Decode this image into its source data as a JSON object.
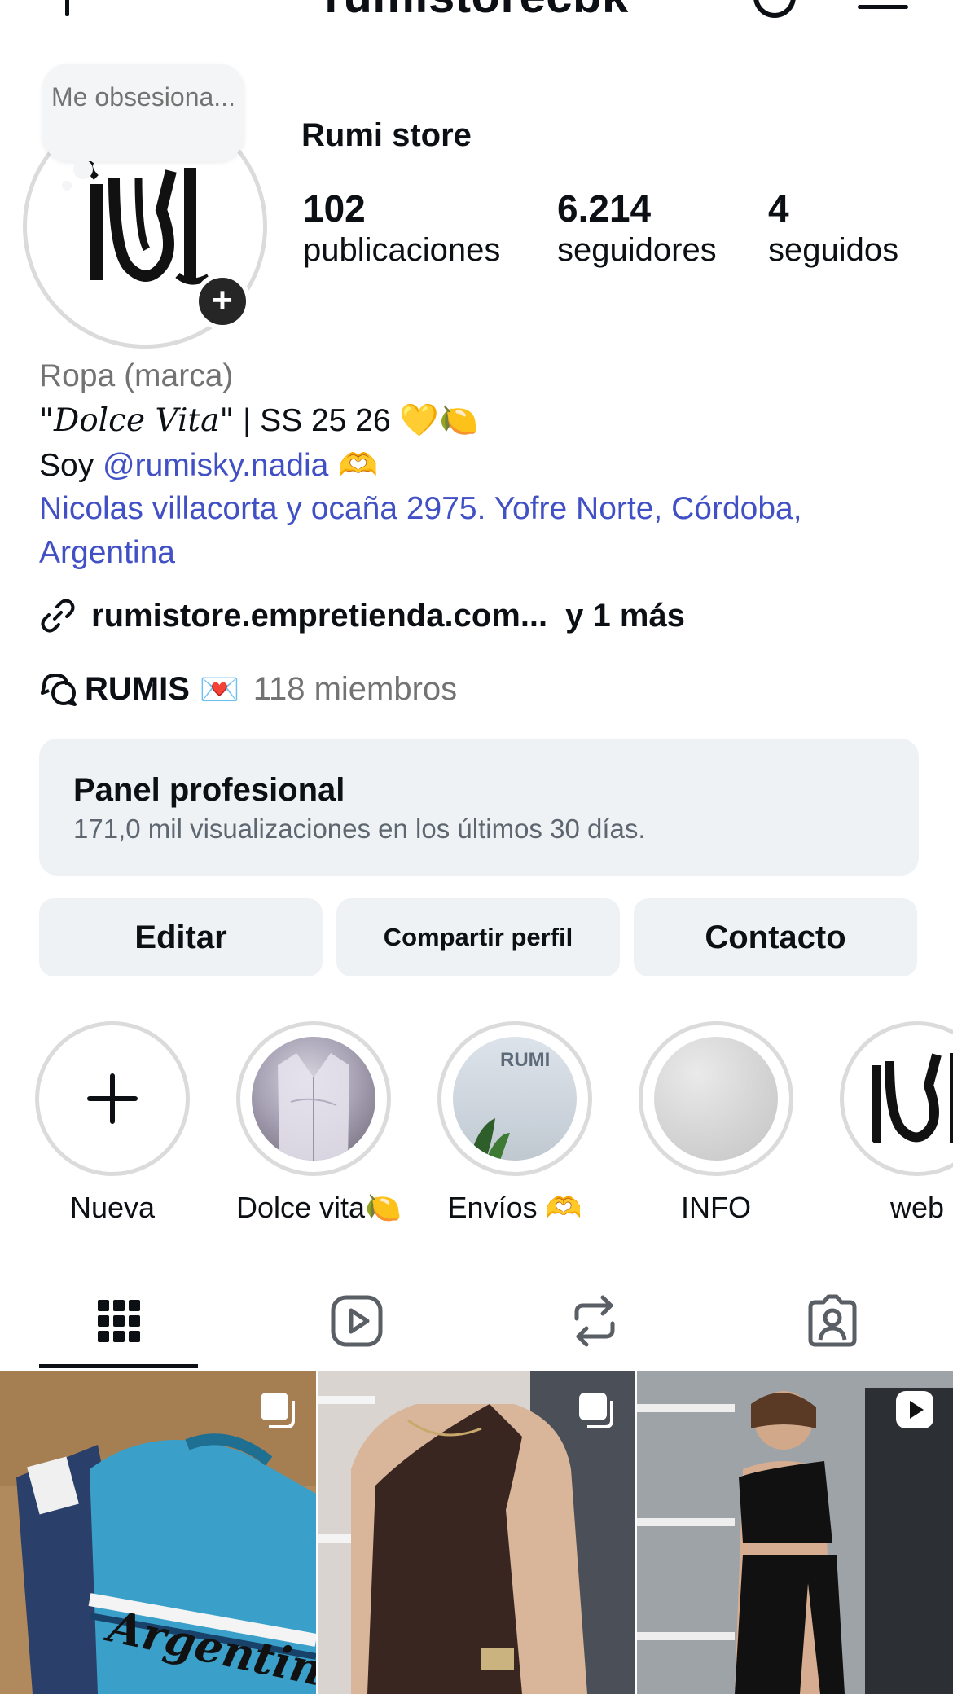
{
  "header": {
    "username": "rumistorecbk"
  },
  "profile": {
    "note": "Me obsesiona...",
    "display_name": "Rumi store",
    "stats": [
      {
        "value": "102",
        "label": "publicaciones"
      },
      {
        "value": "6.214",
        "label": "seguidores"
      },
      {
        "value": "4",
        "label": "seguidos"
      }
    ]
  },
  "bio": {
    "category": "Ropa (marca)",
    "line1_quote": "\"Dolce Vita\"",
    "line1_rest": " | SS 25 26 ",
    "line1_emoji": "💛🍋",
    "line2_prefix": "Soy ",
    "line2_mention": "@rumisky.nadia",
    "line2_emoji": " 🫶",
    "address": "Nicolas villacorta y ocaña 2975. Yofre Norte, Córdoba, Argentina",
    "link_text": "rumistore.empretienda.com...",
    "link_more": "y 1 más",
    "channel_name": "RUMIS",
    "channel_emoji": "💌",
    "channel_members": "118 miembros"
  },
  "panel": {
    "title": "Panel profesional",
    "subtitle": "171,0 mil visualizaciones en los últimos 30 días."
  },
  "buttons": {
    "edit": "Editar",
    "share": "Compartir perfil",
    "contact": "Contacto"
  },
  "highlights": [
    {
      "label": "Nueva"
    },
    {
      "label": "Dolce vita🍋"
    },
    {
      "label": "Envíos 🫶"
    },
    {
      "label": "INFO"
    },
    {
      "label": "web"
    }
  ],
  "highlight_images": {
    "envios_sign": "RUMI"
  },
  "posts": {
    "post1_text": "Argentina"
  },
  "colors": {
    "link": "#4150c4",
    "secondary_text": "#737373",
    "button_bg": "#eff2f5"
  }
}
